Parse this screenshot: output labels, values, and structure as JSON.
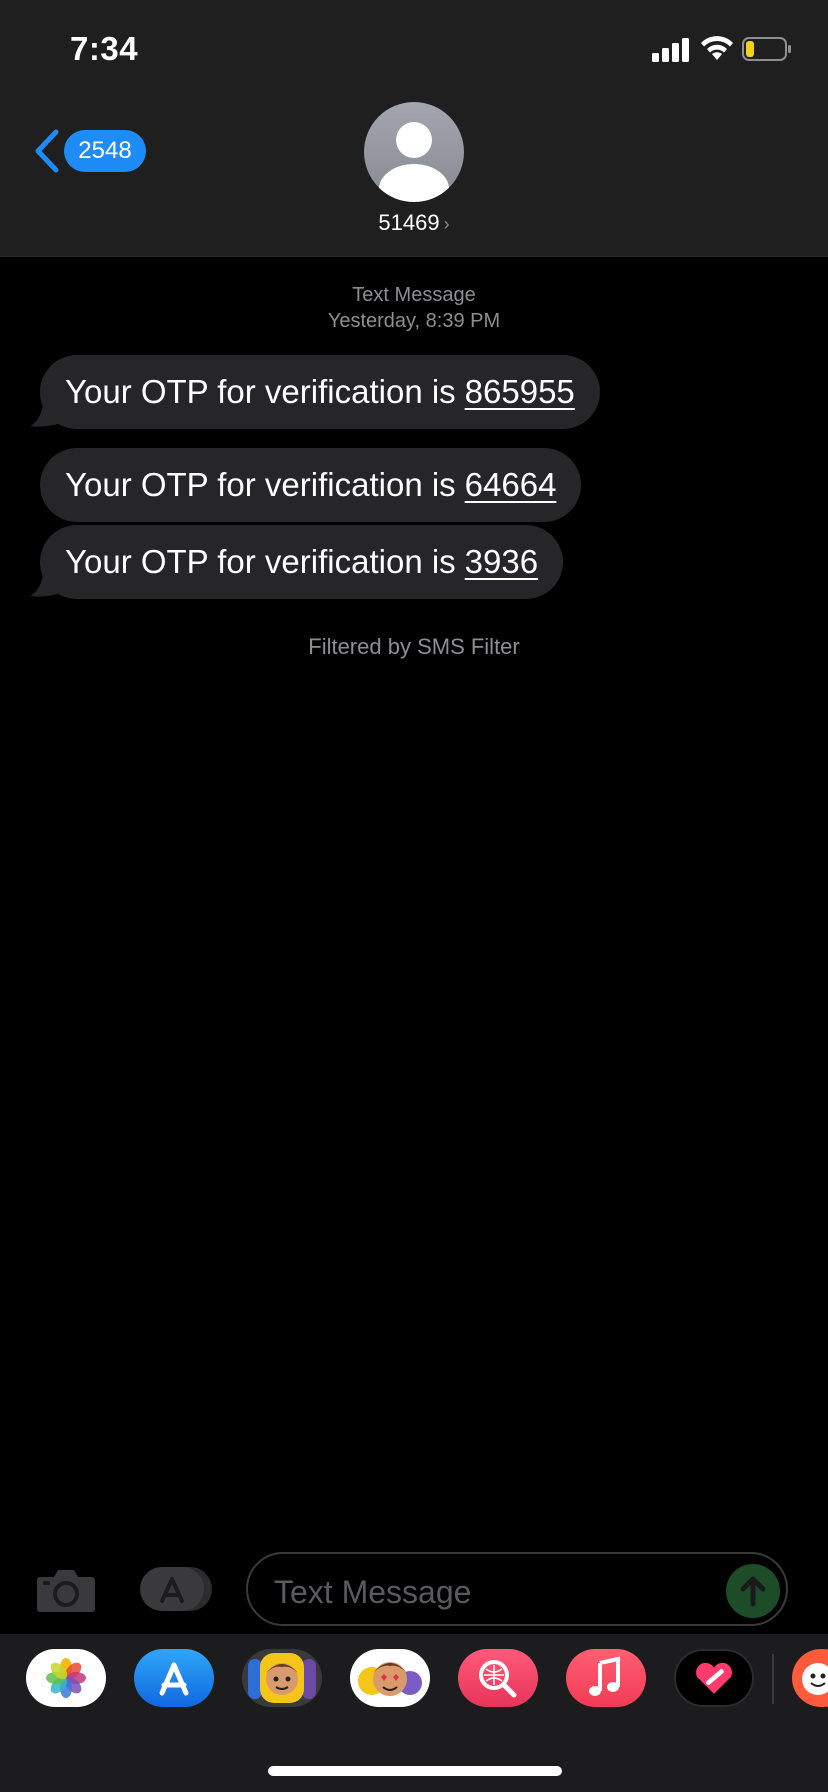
{
  "status_bar": {
    "time": "7:34"
  },
  "nav": {
    "back_count": "2548",
    "contact_name": "51469"
  },
  "conversation": {
    "service": "Text Message",
    "timestamp": "Yesterday, 8:39 PM",
    "messages": [
      {
        "text": "Your OTP for verification is",
        "code": "865955"
      },
      {
        "text": "Your OTP for verification is",
        "code": "64664"
      },
      {
        "text": "Your OTP for verification is",
        "code": "3936"
      }
    ],
    "filter_note": "Filtered by SMS Filter"
  },
  "composer": {
    "placeholder": "Text Message"
  },
  "app_drawer": {
    "apps": [
      "photos-app",
      "app-store-app",
      "memoji-app",
      "animoji-app",
      "image-search-app",
      "music-app",
      "digital-touch-app",
      "more-app"
    ]
  },
  "colors": {
    "accent": "#1d8cf7",
    "bubble": "#262629",
    "header": "#1f1f1f",
    "send": "#1d4d28"
  }
}
